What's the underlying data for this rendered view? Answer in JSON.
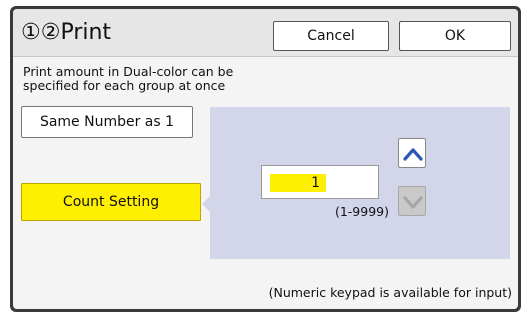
{
  "header": {
    "title": "①②Print",
    "cancel_label": "Cancel",
    "ok_label": "OK"
  },
  "description": {
    "line1": "Print amount in Dual-color can be",
    "line2": "specified for each group at once"
  },
  "options": {
    "same_number_label": "Same Number as 1",
    "count_setting_label": "Count Setting",
    "selected": "Count Setting"
  },
  "count": {
    "value": "1",
    "range": "(1-9999)"
  },
  "footer": {
    "hint": "(Numeric keypad is available for input)"
  },
  "icons": {
    "up": "chevron-up-icon",
    "down": "chevron-down-icon"
  },
  "colors": {
    "accent_yellow": "#ffef00",
    "panel_lavender": "#d3d6ea",
    "arrow_blue": "#2f56b5",
    "disabled_gray": "#c9c9c9"
  }
}
